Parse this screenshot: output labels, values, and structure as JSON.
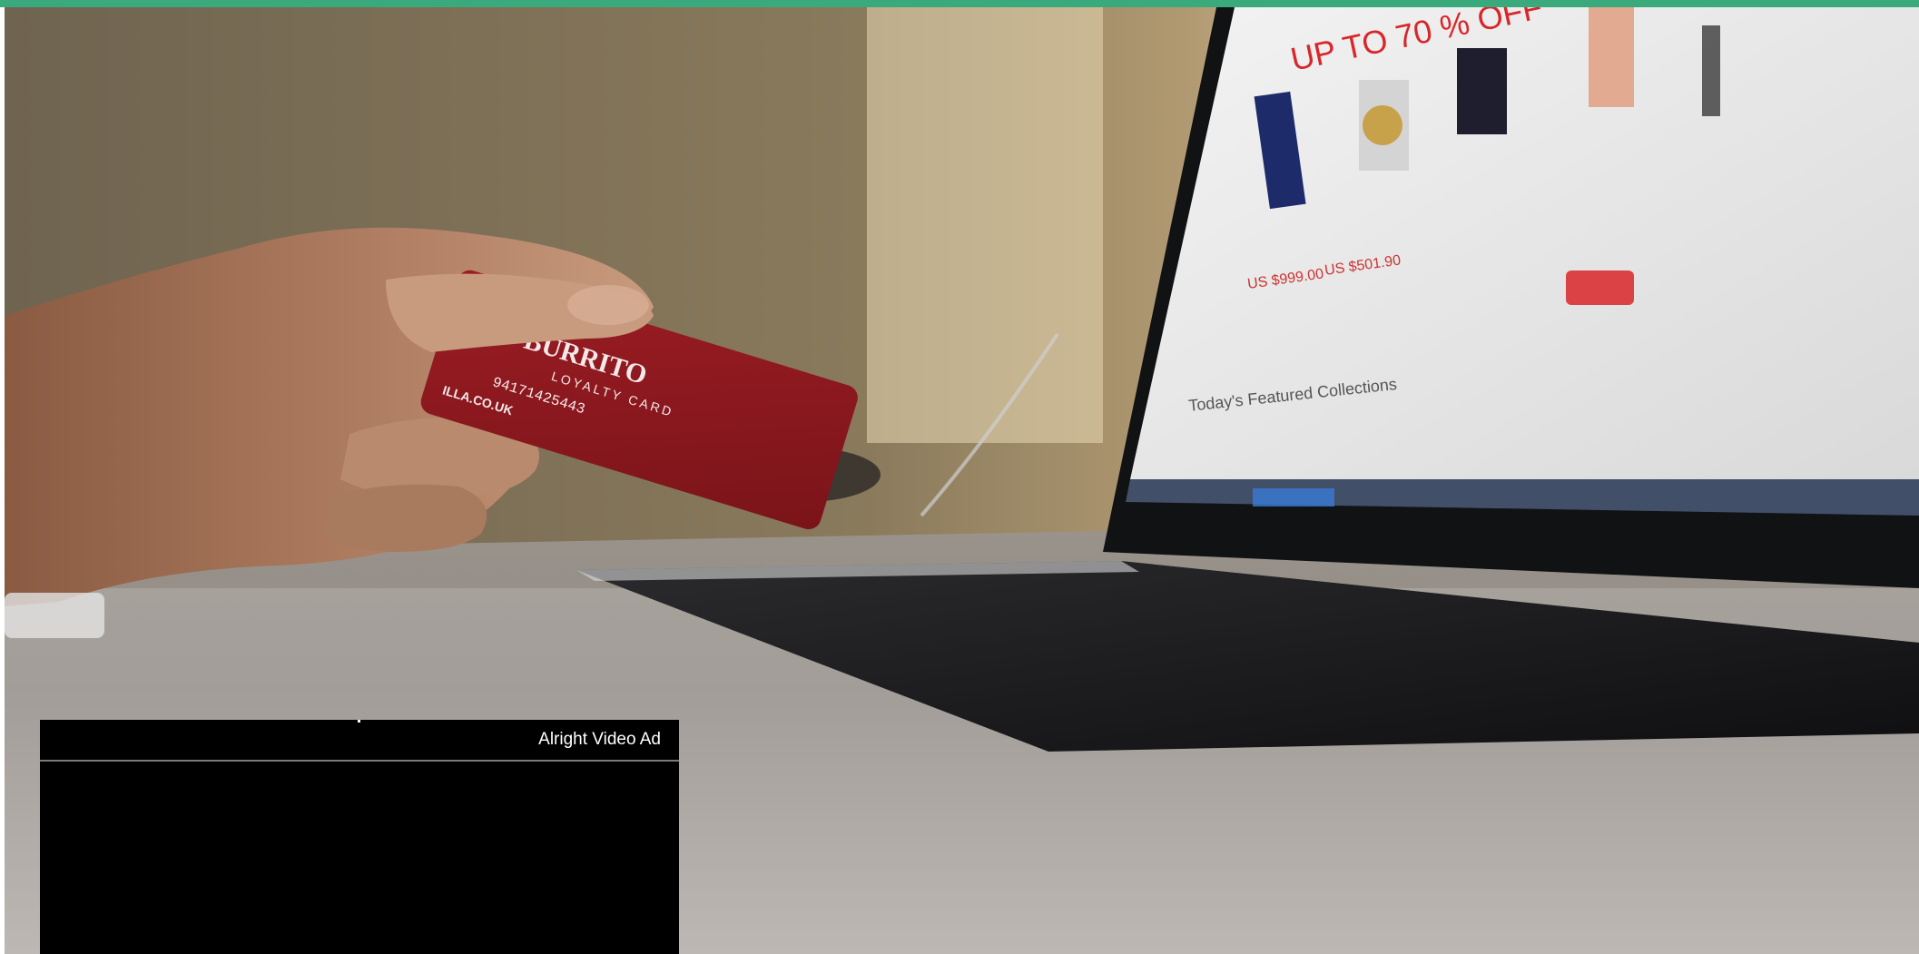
{
  "theme": {
    "accent_color": "#3aaa7d",
    "ad_background": "#000000",
    "ad_text_color": "#ffffff"
  },
  "hero": {
    "subject": "hand-holding-credit-card-laptop-shopping-photo",
    "card_text": {
      "brand": "BURRITO",
      "subtitle": "LOYALTY CARD",
      "number": "94171425443",
      "url": "ILLA.CO.UK"
    },
    "laptop_screen": {
      "banner": "UP TO 70 % OFF",
      "prices": [
        "US $999.00",
        "US $501.90"
      ],
      "section": "Today's Featured Collections"
    }
  },
  "video_ad": {
    "title": "Alright Video Ad"
  }
}
